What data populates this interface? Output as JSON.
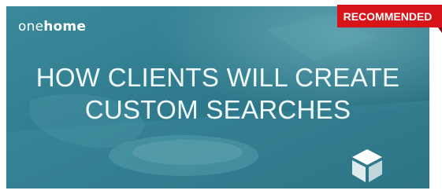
{
  "logo": {
    "part1": "one",
    "part2": "home"
  },
  "title": {
    "line1": "HOW CLIENTS WILL CREATE",
    "line2": "CUSTOM SEARCHES"
  },
  "badge": {
    "label": "RECOMMENDED",
    "color": "#d7141a"
  },
  "icons": {
    "brand_mark": "cube-logo-icon"
  },
  "colors": {
    "overlay": "#2f7c8e",
    "text": "#ffffff"
  }
}
